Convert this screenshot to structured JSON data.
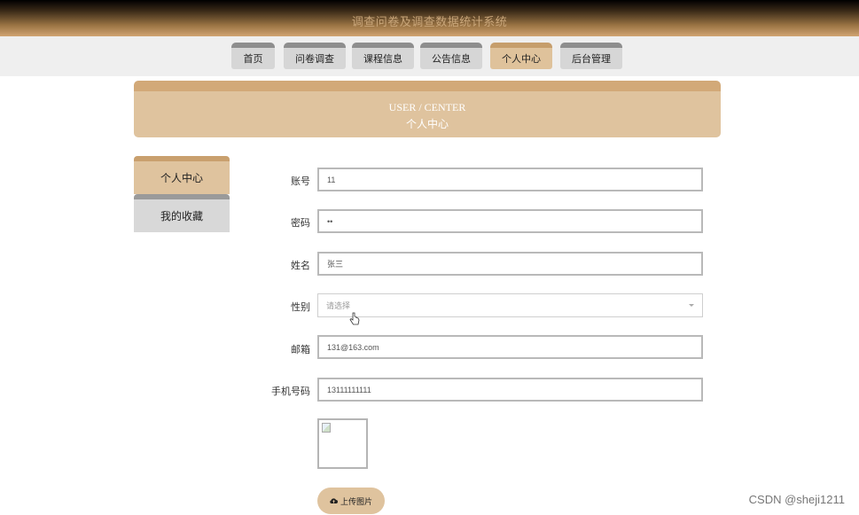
{
  "header": {
    "title": "调查问卷及调查数据统计系统"
  },
  "nav": {
    "items": [
      "首页",
      "问卷调查",
      "课程信息",
      "公告信息",
      "个人中心",
      "后台管理"
    ],
    "active": "个人中心"
  },
  "banner": {
    "en": "USER / CENTER",
    "zh": "个人中心"
  },
  "sidebar": {
    "items": [
      "个人中心",
      "我的收藏"
    ]
  },
  "form": {
    "account_label": "账号",
    "account_value": "11",
    "password_label": "密码",
    "password_value": "••",
    "name_label": "姓名",
    "name_value": "张三",
    "gender_label": "性别",
    "gender_placeholder": "请选择",
    "email_label": "邮箱",
    "email_value": "131@163.com",
    "phone_label": "手机号码",
    "phone_value": "13111111111",
    "upload_label": "上传图片"
  },
  "watermark": "CSDN @sheji1211",
  "colors": {
    "accent": "#dfc39e",
    "accent_dark": "#c9a06e",
    "nav_inactive": "#d6d6d6"
  }
}
